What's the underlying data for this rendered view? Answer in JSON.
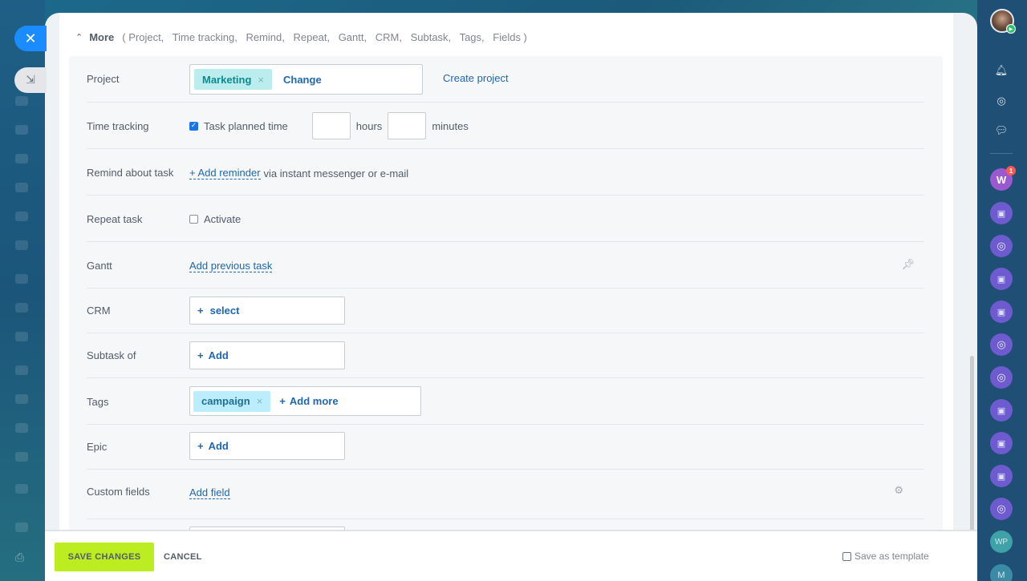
{
  "more": {
    "title": "More",
    "links": [
      "( Project,",
      "Time tracking,",
      "Remind,",
      "Repeat,",
      "Gantt,",
      "CRM,",
      "Subtask,",
      "Tags,",
      "Fields )"
    ]
  },
  "project": {
    "label": "Project",
    "chip": "Marketing",
    "chip_remove": "×",
    "change": "Change",
    "create": "Create project"
  },
  "time_tracking": {
    "label": "Time tracking",
    "checkbox_label": "Task planned time",
    "checked": true,
    "hours_value": "",
    "hours_unit": "hours",
    "minutes_value": "",
    "minutes_unit": "minutes"
  },
  "remind": {
    "label": "Remind about task",
    "add": "+ Add reminder",
    "suffix": "via instant messenger or e-mail"
  },
  "repeat": {
    "label": "Repeat task",
    "checkbox_label": "Activate",
    "checked": false
  },
  "gantt": {
    "label": "Gantt",
    "add": "Add previous task"
  },
  "crm": {
    "label": "CRM",
    "button": "select",
    "plus": "+"
  },
  "subtask": {
    "label": "Subtask of",
    "button": "Add",
    "plus": "+"
  },
  "tags": {
    "label": "Tags",
    "chip": "campaign",
    "chip_remove": "×",
    "add": "Add more",
    "plus": "+"
  },
  "epic": {
    "label": "Epic",
    "button": "Add",
    "plus": "+"
  },
  "custom_fields": {
    "label": "Custom fields",
    "add": "Add field"
  },
  "footer": {
    "save": "SAVE CHANGES",
    "cancel": "CANCEL",
    "template": "Save as template"
  },
  "sidebar": {
    "notification_badge": "1",
    "w_avatar": "W",
    "wp_avatar": "WP",
    "m_avatar": "M"
  },
  "colors": {
    "accent": "#2067b0",
    "save_button": "#bbed21",
    "project_chip": "#bcedee",
    "tag_chip": "#bcedfc",
    "close_button": "#1a8cff"
  }
}
